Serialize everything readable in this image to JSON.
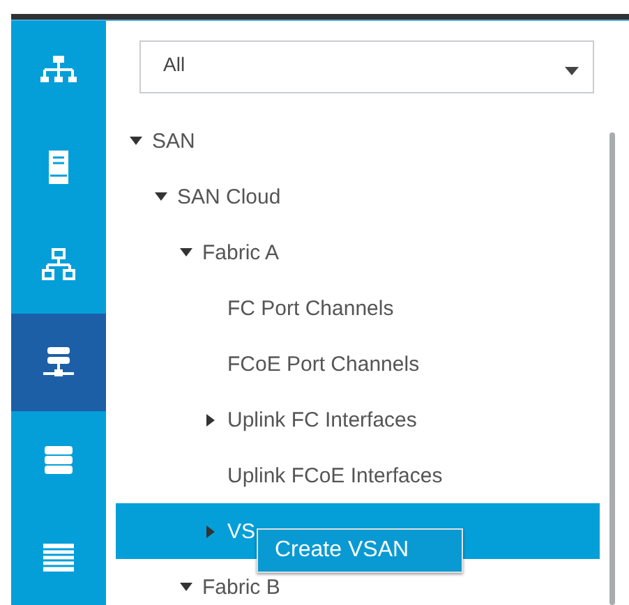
{
  "nav": [
    {
      "kind": "hierarchy",
      "selected": false
    },
    {
      "kind": "server",
      "selected": false
    },
    {
      "kind": "network",
      "selected": false
    },
    {
      "kind": "san",
      "selected": true
    },
    {
      "kind": "storage",
      "selected": false
    },
    {
      "kind": "list",
      "selected": false
    }
  ],
  "filter": {
    "value": "All"
  },
  "tree": [
    {
      "label": "SAN",
      "expanded": true,
      "selected": false,
      "children": [
        {
          "label": "SAN Cloud",
          "expanded": true,
          "selected": false,
          "children": [
            {
              "label": "Fabric A",
              "expanded": true,
              "selected": false,
              "children": [
                {
                  "label": "FC Port Channels",
                  "selected": false
                },
                {
                  "label": "FCoE Port Channels",
                  "selected": false
                },
                {
                  "label": "Uplink FC Interfaces",
                  "expanded": false,
                  "selected": false
                },
                {
                  "label": "Uplink FCoE Interfaces",
                  "selected": false
                },
                {
                  "label": "VS",
                  "expanded": false,
                  "selected": true
                }
              ]
            },
            {
              "label": "Fabric B",
              "expanded": true,
              "selected": false
            }
          ]
        }
      ]
    }
  ],
  "context_menu": {
    "items": [
      "Create VSAN"
    ]
  }
}
